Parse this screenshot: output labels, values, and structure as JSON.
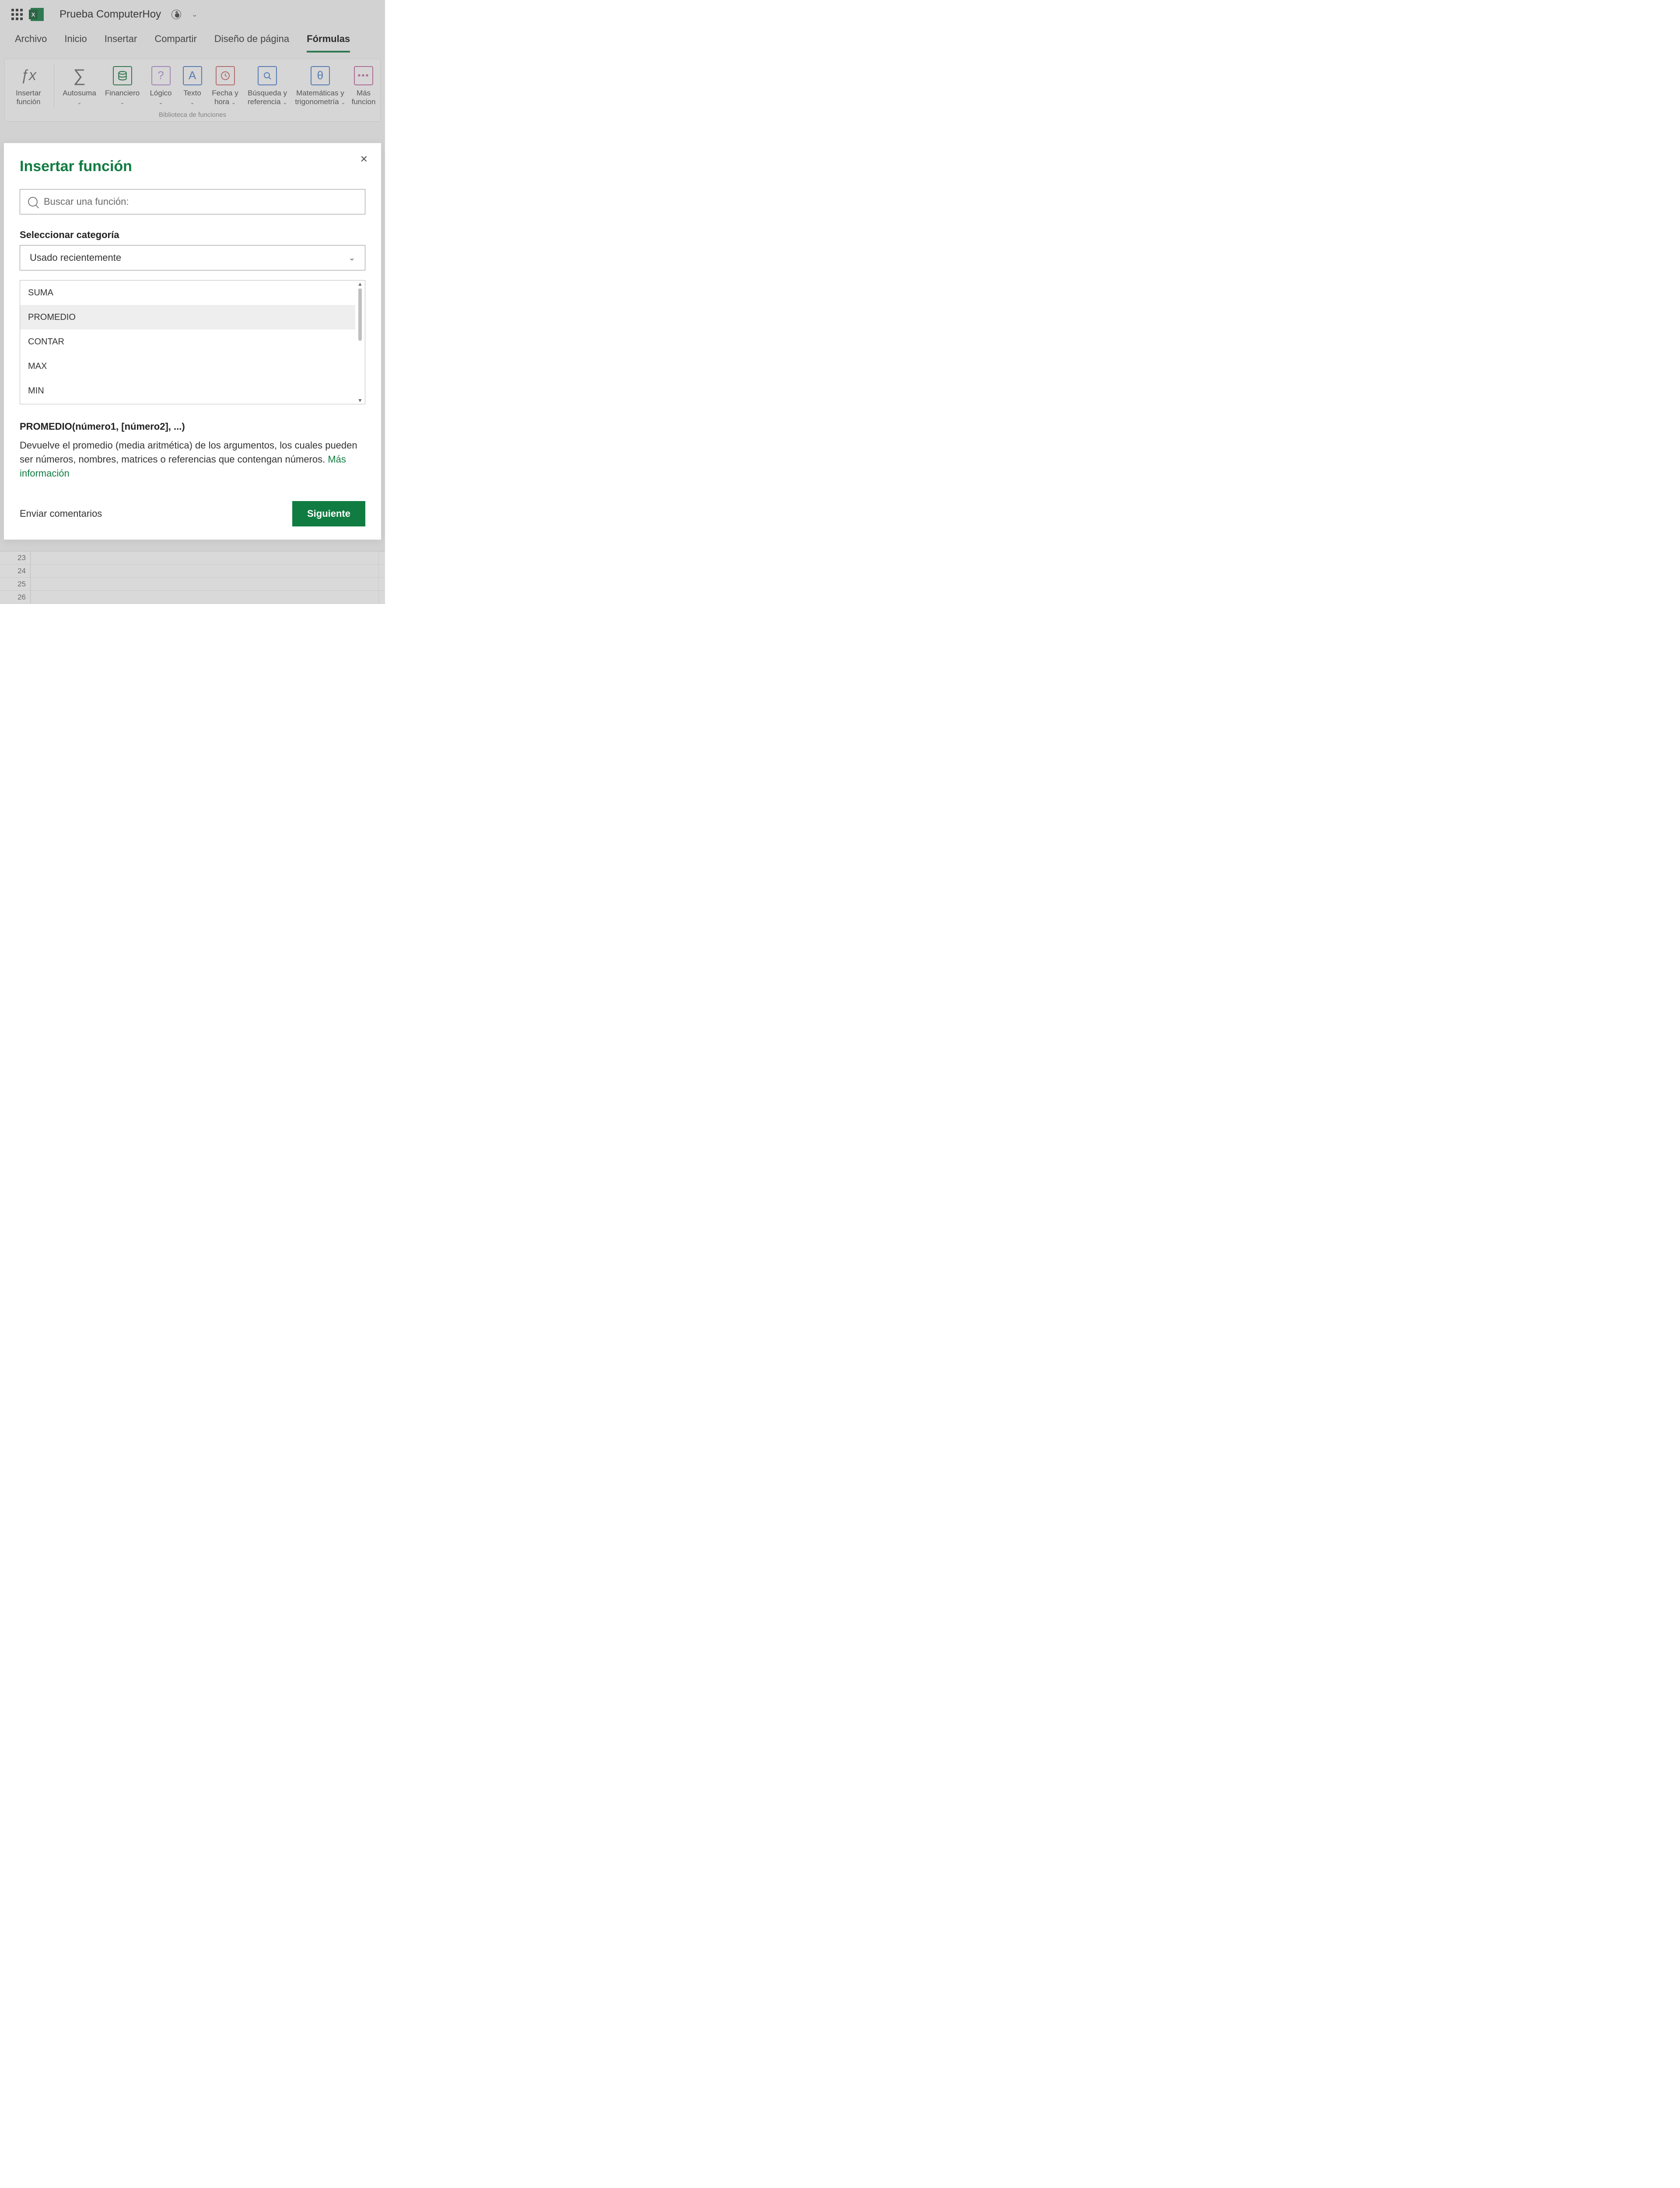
{
  "header": {
    "doc_title": "Prueba ComputerHoy"
  },
  "tabs": {
    "items": [
      "Archivo",
      "Inicio",
      "Insertar",
      "Compartir",
      "Diseño de página",
      "Fórmulas"
    ],
    "active_index": 5
  },
  "ribbon": {
    "buttons": [
      {
        "label": "Insertar función"
      },
      {
        "label": "Autosuma"
      },
      {
        "label": "Financiero"
      },
      {
        "label": "Lógico"
      },
      {
        "label": "Texto"
      },
      {
        "label": "Fecha y hora"
      },
      {
        "label": "Búsqueda y referencia"
      },
      {
        "label": "Matemáticas y trigonometría"
      },
      {
        "label": "Más funcion"
      }
    ],
    "group_caption": "Biblioteca de funciones"
  },
  "dialog": {
    "title": "Insertar función",
    "search_placeholder": "Buscar una función:",
    "category_label": "Seleccionar categoría",
    "category_value": "Usado recientemente",
    "functions": [
      "SUMA",
      "PROMEDIO",
      "CONTAR",
      "MAX",
      "MIN"
    ],
    "selected_index": 1,
    "signature": "PROMEDIO(número1, [número2], ...)",
    "description": "Devuelve el promedio (media aritmética) de los argumentos, los cuales pueden ser números, nombres, matrices o referencias que contengan números. ",
    "more_link": "Más información",
    "feedback": "Enviar comentarios",
    "next": "Siguiente"
  },
  "sheet": {
    "rows": [
      "23",
      "24",
      "25",
      "26"
    ]
  }
}
